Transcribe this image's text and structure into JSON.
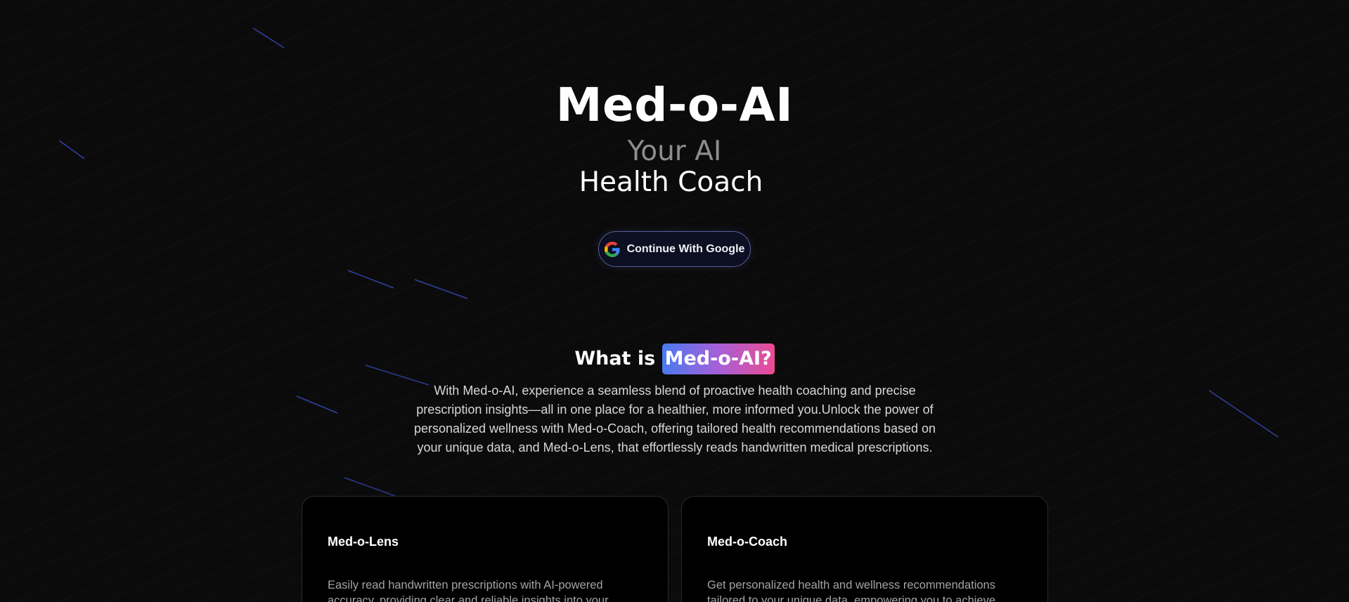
{
  "hero": {
    "title": "Med-o-AI",
    "subtitle_line1": "Your AI",
    "subtitle_line2": "Health Coach"
  },
  "auth": {
    "google_button_label": "Continue With Google",
    "google_icon": "google-g-icon"
  },
  "about": {
    "heading_prefix": "What is",
    "heading_highlight": "Med-o-AI?",
    "description": "With Med-o-AI, experience a seamless blend of proactive health coaching and precise prescription insights—all in one place for a healthier, more informed you.Unlock the power of personalized wellness with Med-o-Coach, offering tailored health recommendations based on your unique data, and Med-o-Lens, that effortlessly reads handwritten medical prescriptions."
  },
  "features": [
    {
      "title": "Med-o-Lens",
      "description": "Easily read handwritten prescriptions with AI-powered accuracy, providing clear and reliable insights into your"
    },
    {
      "title": "Med-o-Coach",
      "description": "Get personalized health and wellness recommendations tailored to your unique data, empowering you to achieve"
    }
  ],
  "colors": {
    "background": "#0b0b0c",
    "highlight_gradient_start": "#4a7bf0",
    "highlight_gradient_end": "#ea4c93",
    "button_border": "#5a5f9a",
    "streak": "#3b4fc4"
  }
}
